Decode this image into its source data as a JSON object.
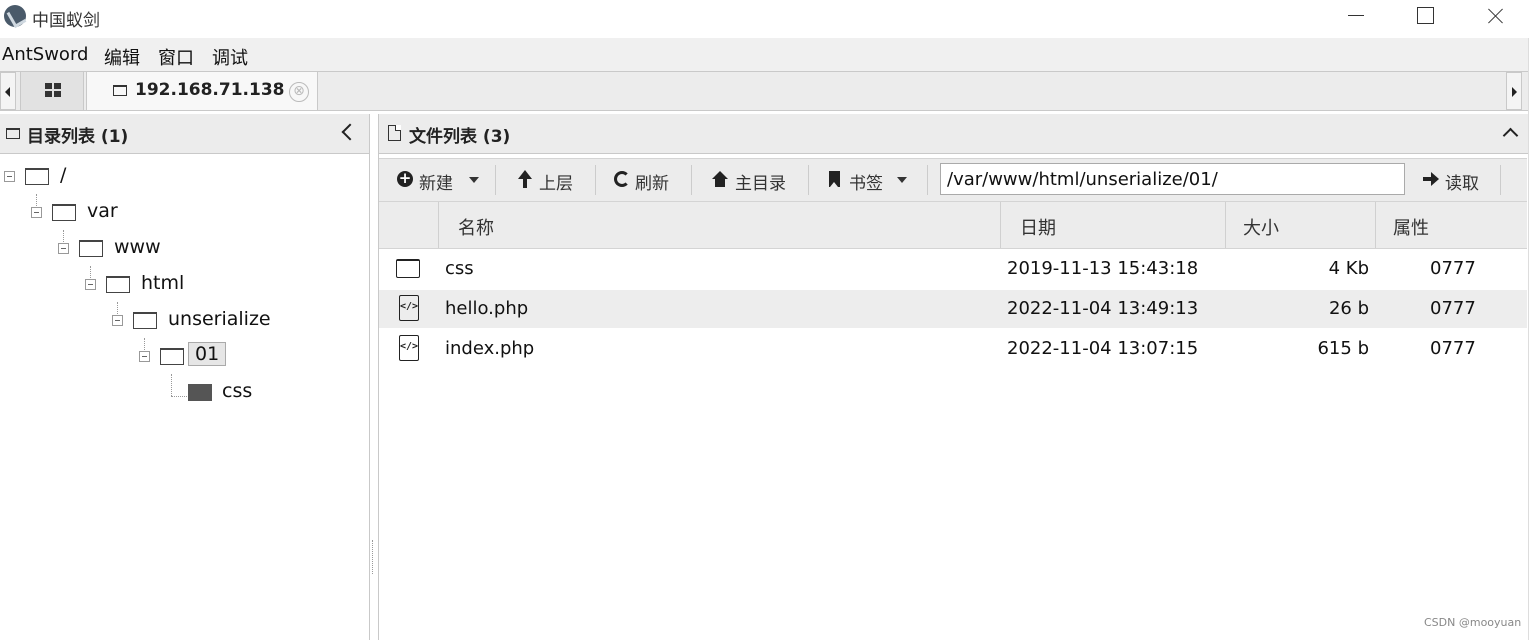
{
  "window": {
    "title": "中国蚁剑"
  },
  "menubar": {
    "items": [
      "AntSword",
      "编辑",
      "窗口",
      "调试"
    ]
  },
  "tabs": {
    "connection_label": "192.168.71.138",
    "close_symbol": "⊗"
  },
  "dir_panel": {
    "title": "目录列表 (1)",
    "tree": [
      {
        "label": "/",
        "depth": 0
      },
      {
        "label": "var",
        "depth": 1
      },
      {
        "label": "www",
        "depth": 2
      },
      {
        "label": "html",
        "depth": 3
      },
      {
        "label": "unserialize",
        "depth": 4
      },
      {
        "label": "01",
        "depth": 5,
        "selected": true
      },
      {
        "label": "css",
        "depth": 6
      }
    ]
  },
  "file_panel": {
    "title": "文件列表 (3)",
    "toolbar": {
      "new_label": "新建",
      "up_label": "上层",
      "refresh_label": "刷新",
      "home_label": "主目录",
      "bookmark_label": "书签",
      "path_value": "/var/www/html/unserialize/01/",
      "read_label": "读取"
    },
    "columns": [
      "名称",
      "日期",
      "大小",
      "属性"
    ],
    "rows": [
      {
        "icon": "folder-icon",
        "name": "css",
        "date": "2019-11-13 15:43:18",
        "size": "4 Kb",
        "attr": "0777"
      },
      {
        "icon": "php-file-icon",
        "name": "hello.php",
        "date": "2022-11-04 13:49:13",
        "size": "26 b",
        "attr": "0777"
      },
      {
        "icon": "php-file-icon",
        "name": "index.php",
        "date": "2022-11-04 13:07:15",
        "size": "615 b",
        "attr": "0777"
      }
    ]
  },
  "watermark": "CSDN @mooyuan"
}
